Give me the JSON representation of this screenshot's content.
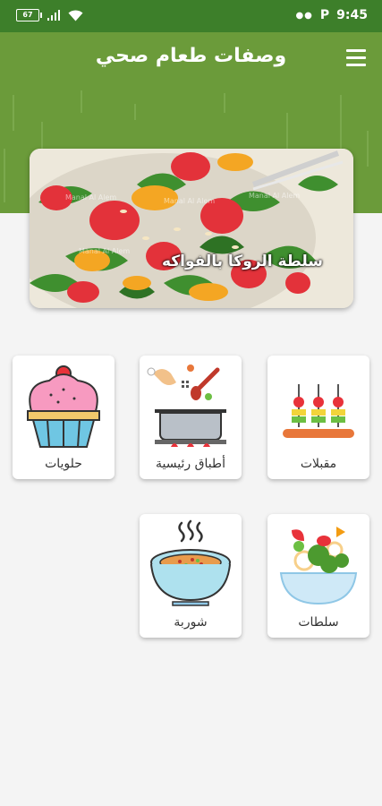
{
  "status_bar": {
    "battery": "67",
    "time": "9:45",
    "notification_letter": "P"
  },
  "app_bar": {
    "title": "وصفات طعام صحي",
    "menu_icon": "hamburger-menu-icon"
  },
  "banner": {
    "caption": "سلطة الروكا بالفواكه",
    "watermark": "Manal Al Alem"
  },
  "categories": [
    {
      "label": "مقبلات",
      "icon": "skewers-icon"
    },
    {
      "label": "أطباق رئيسية",
      "icon": "cooking-pot-icon"
    },
    {
      "label": "حلويات",
      "icon": "cupcake-icon"
    },
    {
      "label": "سلطات",
      "icon": "salad-bowl-icon"
    },
    {
      "label": "شوربة",
      "icon": "soup-bowl-icon"
    }
  ],
  "colors": {
    "status_bar": "#3d7f2a",
    "app_bar": "#6b9b3a",
    "background": "#f4f4f4"
  }
}
